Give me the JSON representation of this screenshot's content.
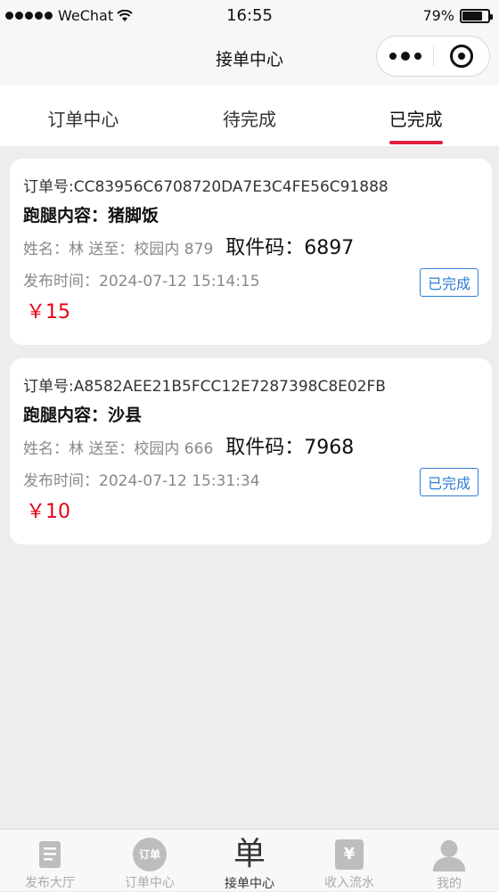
{
  "status_bar": {
    "carrier": "WeChat",
    "time": "16:55",
    "battery": "79%",
    "battery_level": 0.79
  },
  "nav": {
    "title": "接单中心"
  },
  "tabs": [
    {
      "label": "订单中心",
      "active": false
    },
    {
      "label": "待完成",
      "active": false
    },
    {
      "label": "已完成",
      "active": true
    }
  ],
  "orders": [
    {
      "order_no": "订单号:CC83956C6708720DA7E3C4FE56C91888",
      "content": "跑腿内容：猪脚饭",
      "info": "姓名：林 送至：校园内 879",
      "pickup": "取件码：6897",
      "time": "发布时间：2024-07-12 15:14:15",
      "price": "￥15",
      "status": "已完成"
    },
    {
      "order_no": "订单号:A8582AEE21B5FCC12E7287398C8E02FB",
      "content": "跑腿内容：沙县",
      "info": "姓名：林 送至：校园内 666",
      "pickup": "取件码：7968",
      "time": "发布时间：2024-07-12 15:31:34",
      "price": "￥10",
      "status": "已完成"
    }
  ],
  "tab_bar": [
    {
      "label": "发布大厅",
      "icon": "document-icon",
      "active": false
    },
    {
      "label": "订单中心",
      "icon": "order-circle-icon",
      "icon_text": "订单",
      "active": false
    },
    {
      "label": "接单中心",
      "icon": "dan-char-icon",
      "icon_text": "单",
      "active": true
    },
    {
      "label": "收入流水",
      "icon": "yen-ticket-icon",
      "icon_text": "¥",
      "active": false
    },
    {
      "label": "我的",
      "icon": "user-icon",
      "active": false
    }
  ],
  "colors": {
    "accent_red": "#e0203a",
    "price_red": "#e60012",
    "badge_blue": "#2f7dd6"
  }
}
